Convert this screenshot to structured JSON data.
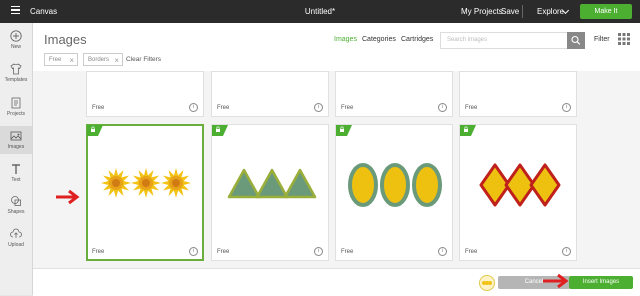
{
  "topbar": {
    "app_name": "Canvas",
    "doc_title": "Untitled*",
    "my_projects": "My Projects",
    "save": "Save",
    "explore": "Explore",
    "make_it": "Make It",
    "accent_color": "#4caf32"
  },
  "rail": {
    "items": [
      {
        "label": "New",
        "icon": "plus-icon"
      },
      {
        "label": "Templates",
        "icon": "shirt-icon"
      },
      {
        "label": "Projects",
        "icon": "projects-icon"
      },
      {
        "label": "Images",
        "icon": "images-icon"
      },
      {
        "label": "Text",
        "icon": "text-icon"
      },
      {
        "label": "Shapes",
        "icon": "shapes-icon"
      },
      {
        "label": "Upload",
        "icon": "upload-icon"
      }
    ],
    "active": "Images"
  },
  "panel": {
    "title": "Images",
    "tabs": [
      {
        "label": "Images",
        "active": true
      },
      {
        "label": "Categories",
        "active": false
      },
      {
        "label": "Cartridges",
        "active": false
      }
    ],
    "search_placeholder": "Search images",
    "filter_label": "Filter",
    "chips": [
      {
        "label": "Free"
      },
      {
        "label": "Borders"
      }
    ],
    "clear_filters": "Clear Filters"
  },
  "cards": {
    "row1": [
      {
        "label": "Free"
      },
      {
        "label": "Free"
      },
      {
        "label": "Free"
      },
      {
        "label": "Free"
      }
    ],
    "row2": [
      {
        "label": "Free",
        "art": "sunflower-border",
        "selected": true
      },
      {
        "label": "Free",
        "art": "triangle-border",
        "selected": false
      },
      {
        "label": "Free",
        "art": "oval-border",
        "selected": false
      },
      {
        "label": "Free",
        "art": "diamond-border",
        "selected": false
      }
    ],
    "info_glyph": "i"
  },
  "footer": {
    "cancel": "Cancel",
    "insert": "Insert Images"
  }
}
